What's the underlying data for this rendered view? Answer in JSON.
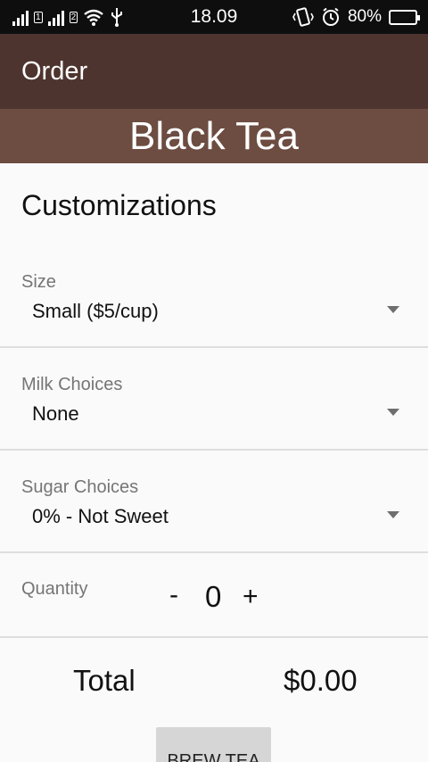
{
  "status_bar": {
    "time": "18.09",
    "battery_percent": "80%",
    "icons": [
      "signal-icon",
      "sim-1-icon",
      "signal-icon",
      "sim-2-icon",
      "wifi-icon",
      "usb-icon",
      "vibrate-icon",
      "alarm-icon",
      "battery-icon"
    ],
    "sim_1_label": "1",
    "sim_2_label": "2",
    "battery_level": 0.8
  },
  "app_bar": {
    "title": "Order"
  },
  "product": {
    "name": "Black Tea"
  },
  "customizations": {
    "heading": "Customizations",
    "size": {
      "label": "Size",
      "value": "Small ($5/cup)"
    },
    "milk": {
      "label": "Milk Choices",
      "value": "None"
    },
    "sugar": {
      "label": "Sugar Choices",
      "value": "0% - Not Sweet"
    }
  },
  "quantity": {
    "label": "Quantity",
    "decrement": "-",
    "value": "0",
    "increment": "+"
  },
  "total": {
    "label": "Total",
    "value": "$0.00"
  },
  "actions": {
    "brew_label": "BREW TEA"
  },
  "colors": {
    "app_bar": "#4e342e",
    "banner": "#6d4c41",
    "background": "#fafafa",
    "status_bar": "#0e0e0e",
    "button": "#d6d6d6"
  }
}
